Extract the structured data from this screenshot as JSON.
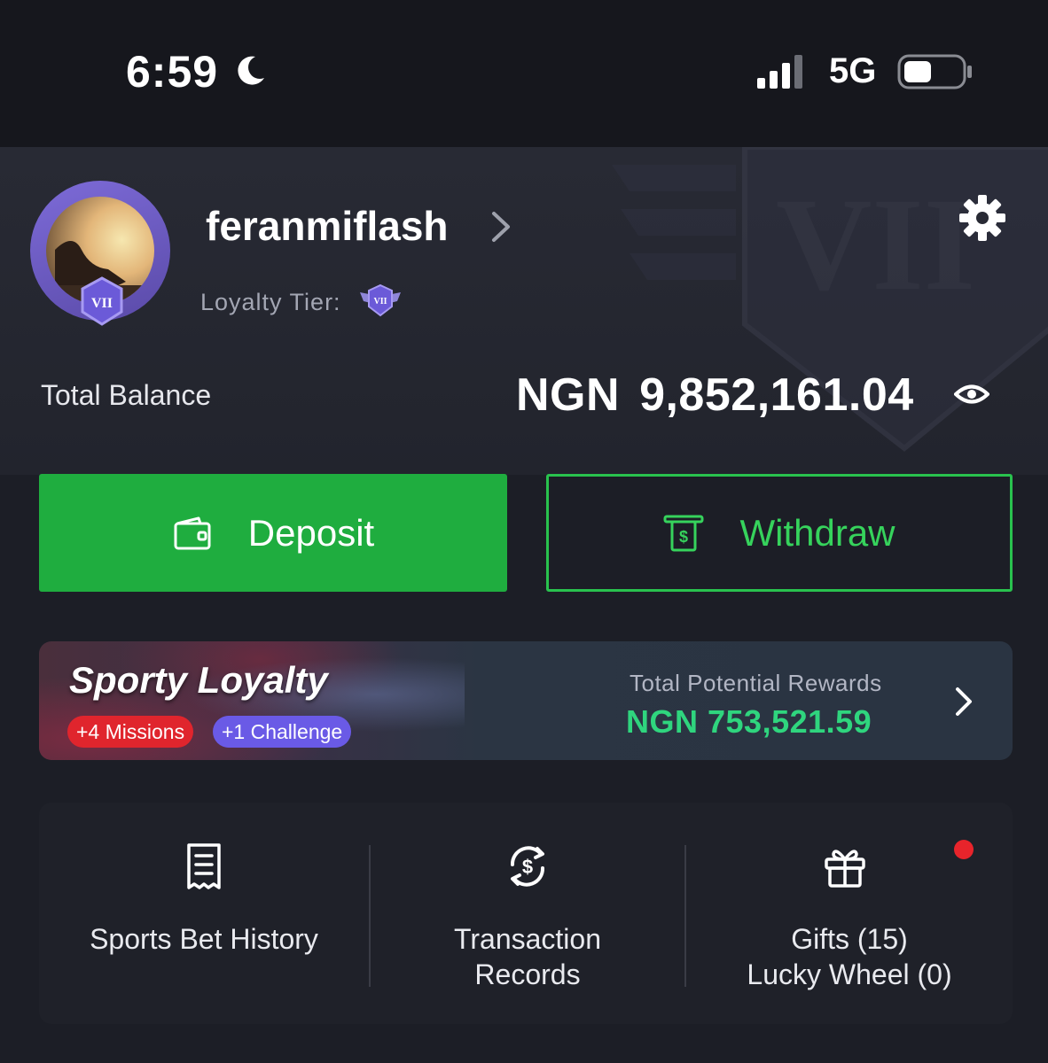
{
  "status_bar": {
    "time": "6:59",
    "network": "5G"
  },
  "profile": {
    "username": "feranmiflash",
    "loyalty_label": "Loyalty Tier:",
    "tier": "VII"
  },
  "balance": {
    "label": "Total Balance",
    "currency": "NGN",
    "amount": "9,852,161.04"
  },
  "actions": {
    "deposit_label": "Deposit",
    "withdraw_label": "Withdraw"
  },
  "loyalty_banner": {
    "title": "Sporty Loyalty",
    "missions": "+4 Missions",
    "challenge": "+1 Challenge",
    "rewards_label": "Total Potential Rewards",
    "rewards_value": "NGN 753,521.59"
  },
  "quick_links": [
    {
      "label_line1": "Sports Bet History",
      "label_line2": ""
    },
    {
      "label_line1": "Transaction",
      "label_line2": "Records"
    },
    {
      "label_line1": "Gifts (15)",
      "label_line2": "Lucky Wheel (0)"
    }
  ],
  "colors": {
    "background": "#1c1e26",
    "deposit_green": "#1fad3f",
    "withdraw_green": "#36d35c",
    "rewards_green": "#2fd57e",
    "tier_purple": "#6a5ae6",
    "alert_red": "#e8242b"
  },
  "icons": [
    "moon-icon",
    "signal-icon",
    "battery-icon",
    "tier-badge-icon",
    "chevron-right-icon",
    "gear-icon",
    "eye-icon",
    "wallet-icon",
    "withdraw-cash-icon",
    "bet-slip-icon",
    "exchange-dollar-icon",
    "gift-icon"
  ]
}
